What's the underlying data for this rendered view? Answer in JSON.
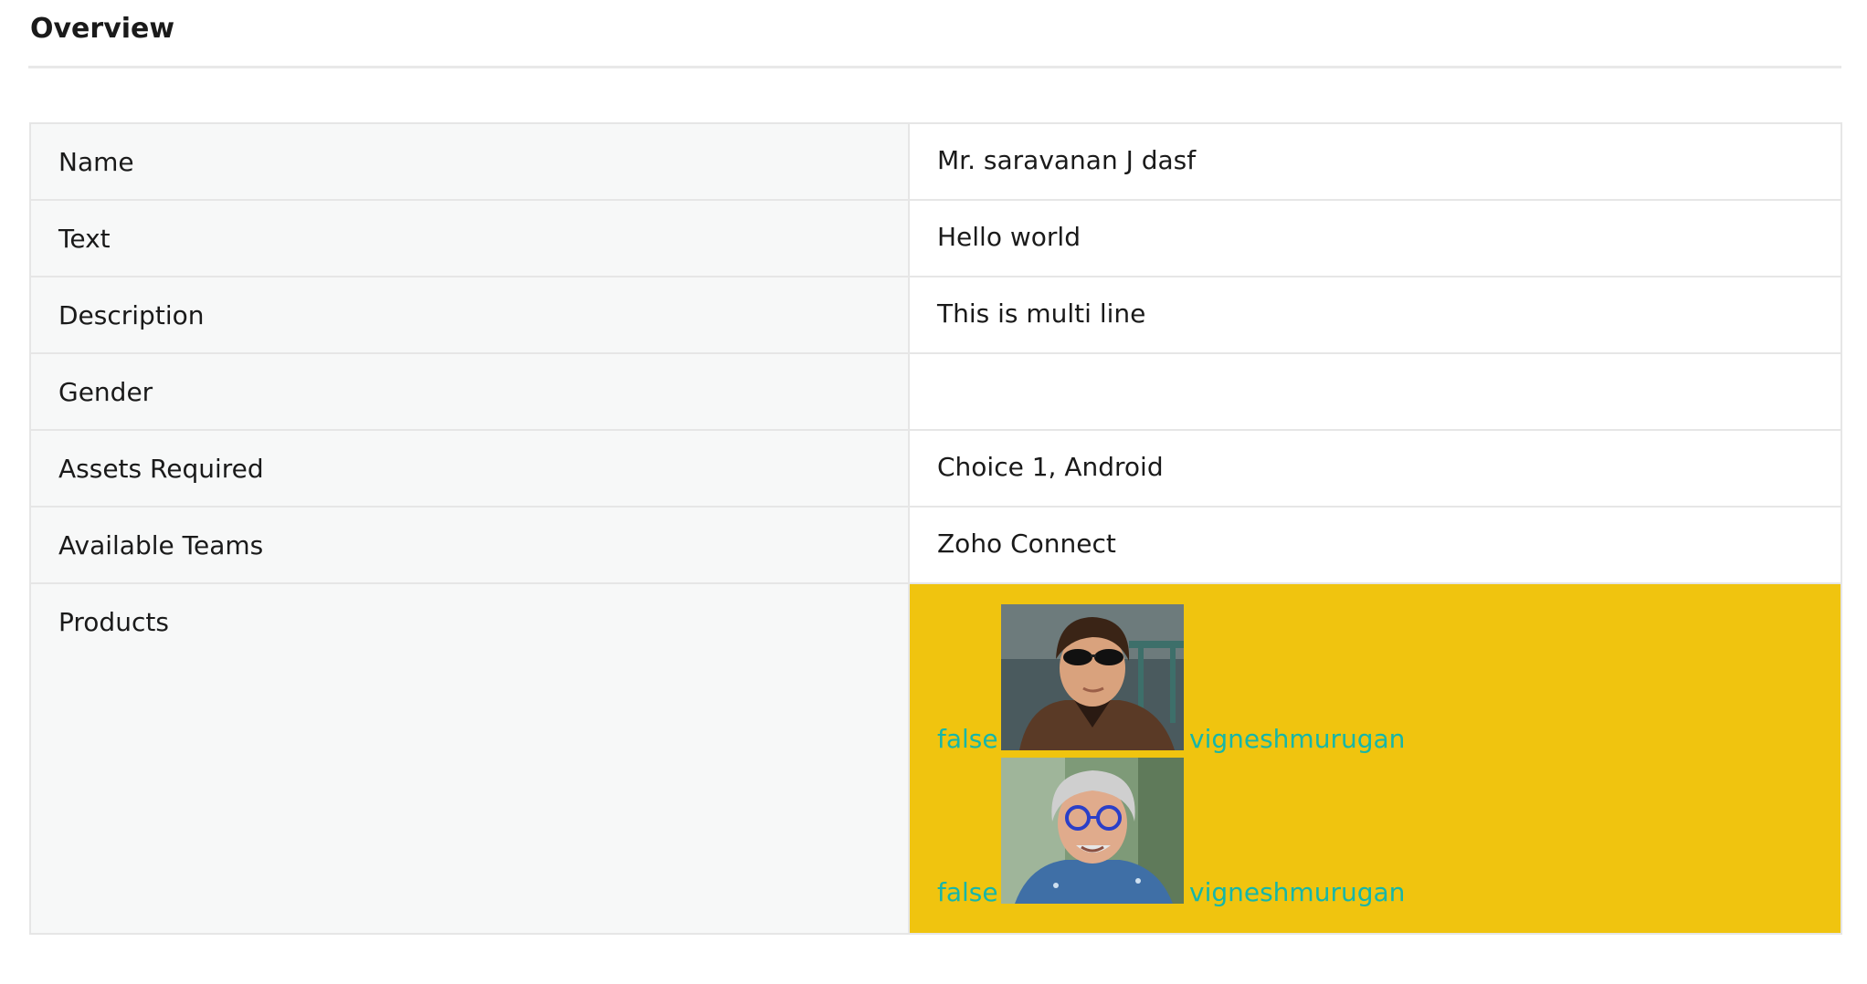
{
  "page": {
    "title": "Overview"
  },
  "fields": [
    {
      "label": "Name",
      "value": "Mr. saravanan J dasf"
    },
    {
      "label": "Text",
      "value": "Hello world"
    },
    {
      "label": "Description",
      "value": "This is multi line"
    },
    {
      "label": "Gender",
      "value": ""
    },
    {
      "label": "Assets Required",
      "value": "Choice 1, Android"
    },
    {
      "label": "Available Teams",
      "value": "Zoho Connect"
    }
  ],
  "products": {
    "label": "Products",
    "background": "#f0c40f",
    "link_color": "#16b6a9",
    "entries": [
      {
        "flag": "false",
        "user": "vigneshmurugan",
        "avatar": "avatar-photo"
      },
      {
        "flag": "false",
        "user": "vigneshmurugan",
        "avatar": "avatar-photo"
      }
    ]
  }
}
